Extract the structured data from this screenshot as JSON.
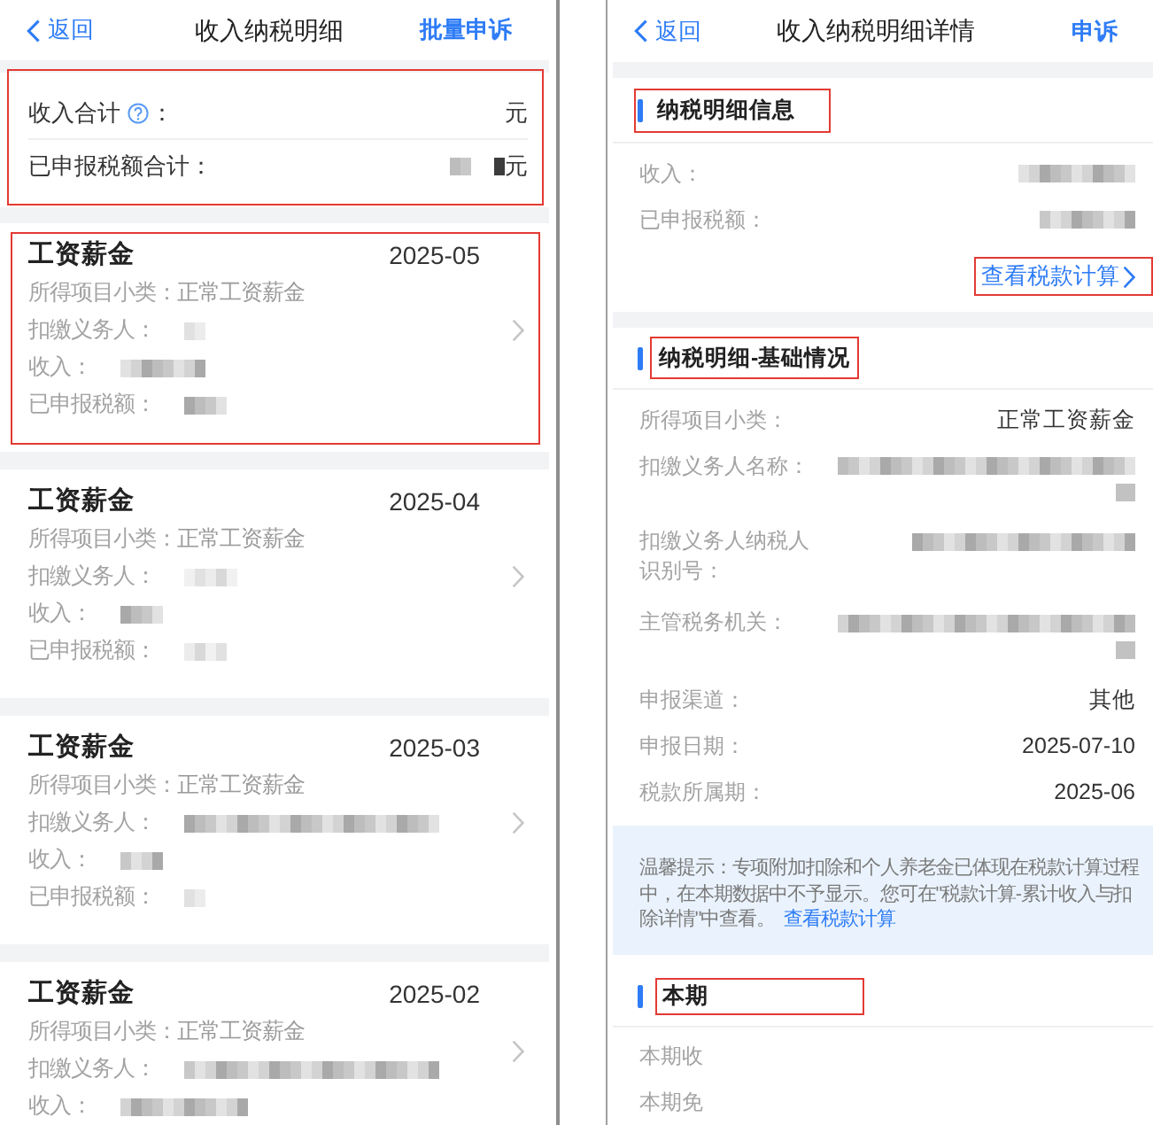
{
  "left_screen": {
    "nav_bar": {
      "back": "返回",
      "title": "收入纳税明细",
      "action": "批量申诉"
    },
    "summary": {
      "annotated": true,
      "rows": [
        {
          "label": "收入合计",
          "help": true,
          "label_end": "：",
          "value_redacted": false,
          "unit": "元"
        },
        {
          "label": "已申报税额合计：",
          "help": false,
          "value_redacted": true,
          "unit": "元"
        }
      ]
    },
    "records": [
      {
        "title": "工资薪金",
        "period": "2025-05",
        "annotated": true,
        "fields": [
          {
            "label": "所得项目小类：",
            "value": "正常工资薪金"
          },
          {
            "label": "扣缴义务人：",
            "redacted": true
          },
          {
            "label": "收入：",
            "redacted": true
          },
          {
            "label": "已申报税额：",
            "redacted": true
          }
        ]
      },
      {
        "title": "工资薪金",
        "period": "2025-04",
        "annotated": false,
        "fields": [
          {
            "label": "所得项目小类：",
            "value": "正常工资薪金"
          },
          {
            "label": "扣缴义务人：",
            "redacted": true
          },
          {
            "label": "收入：",
            "redacted": true
          },
          {
            "label": "已申报税额：",
            "redacted": true
          }
        ]
      },
      {
        "title": "工资薪金",
        "period": "2025-03",
        "annotated": false,
        "fields": [
          {
            "label": "所得项目小类：",
            "value": "正常工资薪金"
          },
          {
            "label": "扣缴义务人：",
            "redacted": true
          },
          {
            "label": "收入：",
            "redacted": true
          },
          {
            "label": "已申报税额：",
            "redacted": true
          }
        ]
      },
      {
        "title": "工资薪金",
        "period": "2025-02",
        "annotated": false,
        "fields": [
          {
            "label": "所得项目小类：",
            "value": "正常工资薪金"
          },
          {
            "label": "扣缴义务人：",
            "redacted": true
          },
          {
            "label": "收入：",
            "redacted": true
          }
        ]
      }
    ]
  },
  "right_screen": {
    "nav_bar": {
      "back": "返回",
      "title": "收入纳税明细详情",
      "action": "申诉"
    },
    "blocks": [
      {
        "kind": "section",
        "heading": "纳税明细信息",
        "annotated": true,
        "fields": [
          {
            "label": "收入：",
            "redacted": true
          },
          {
            "label": "已申报税额：",
            "redacted": true
          }
        ],
        "link": {
          "text": "查看税款计算",
          "annotated": true
        }
      },
      {
        "kind": "section",
        "heading": "纳税明细-基础情况",
        "annotated": true,
        "fields": [
          {
            "label": "所得项目小类：",
            "value": "正常工资薪金"
          },
          {
            "label": "扣缴义务人名称：",
            "redacted": true
          },
          {
            "label": "扣缴义务人纳税人识别号：",
            "redacted": true
          },
          {
            "label": "主管税务机关：",
            "redacted": true
          },
          {
            "label": "申报渠道：",
            "value": "其他"
          },
          {
            "label": "申报日期：",
            "value": "2025-07-10"
          },
          {
            "label": "税款所属期：",
            "value": "2025-06"
          }
        ]
      },
      {
        "kind": "notice",
        "text": "温馨提示：专项附加扣除和个人养老金已体现在税款计算过程中，在本期数据中不予显示。您可在\"税款计算-累计收入与扣除详情\"中查看。",
        "link": "查看税款计算"
      },
      {
        "kind": "section",
        "heading": "本期",
        "annotated": true,
        "fields": [
          {
            "label": "本期收"
          },
          {
            "label": "本期免"
          }
        ]
      }
    ]
  }
}
